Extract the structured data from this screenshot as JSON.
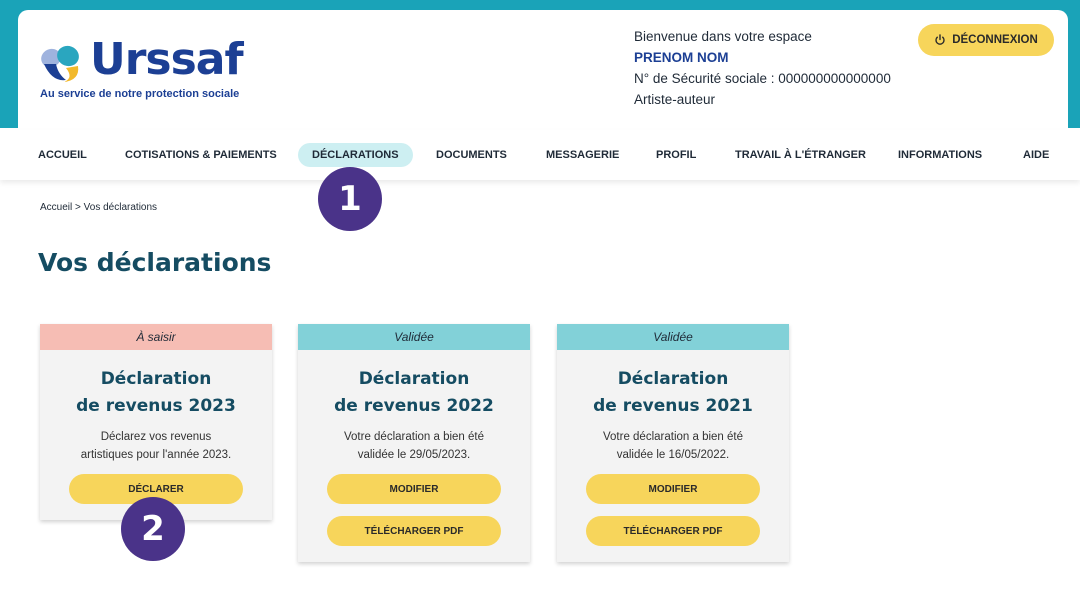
{
  "colors": {
    "header_band": "#1aa3b8",
    "brand_blue": "#1c3f94",
    "title_teal": "#154c62",
    "button_yellow": "#f7d55b",
    "status_todo": "#f6bdb4",
    "status_validated": "#82d1d8",
    "badge_purple": "#4a3389",
    "nav_active": "#cdeff2"
  },
  "logo": {
    "wordmark": "Urssaf",
    "tagline": "Au service de notre protection sociale",
    "icon": "urssaf-logo-icon"
  },
  "user": {
    "welcome": "Bienvenue dans votre espace",
    "name": "PRENOM NOM",
    "ssn_line": "N° de Sécurité sociale : 000000000000000",
    "status": "Artiste-auteur"
  },
  "logout": {
    "label": "DÉCONNEXION",
    "icon": "power-icon"
  },
  "nav": {
    "items": [
      {
        "label": "ACCUEIL"
      },
      {
        "label": "COTISATIONS & PAIEMENTS"
      },
      {
        "label": "DÉCLARATIONS"
      },
      {
        "label": "DOCUMENTS"
      },
      {
        "label": "MESSAGERIE"
      },
      {
        "label": "PROFIL"
      },
      {
        "label": "TRAVAIL À L'ÉTRANGER"
      },
      {
        "label": "INFORMATIONS"
      },
      {
        "label": "AIDE"
      }
    ]
  },
  "badges": [
    "1",
    "2"
  ],
  "breadcrumb": {
    "home": "Accueil",
    "separator": ">",
    "current": "Vos déclarations"
  },
  "page_title": "Vos déclarations",
  "cards": [
    {
      "status": "À saisir",
      "title_line1": "Déclaration",
      "title_line2": "de revenus 2023",
      "text_line1": "Déclarez vos revenus",
      "text_line2": "artistiques pour l'année 2023.",
      "button1": "DÉCLARER"
    },
    {
      "status": "Validée",
      "title_line1": "Déclaration",
      "title_line2": "de revenus 2022",
      "text_line1": "Votre déclaration a bien été",
      "text_line2": "validée le 29/05/2023.",
      "button1": "MODIFIER",
      "button2": "TÉLÉCHARGER PDF"
    },
    {
      "status": "Validée",
      "title_line1": "Déclaration",
      "title_line2": "de revenus 2021",
      "text_line1": "Votre déclaration a bien été",
      "text_line2": "validée le 16/05/2022.",
      "button1": "MODIFIER",
      "button2": "TÉLÉCHARGER PDF"
    }
  ]
}
